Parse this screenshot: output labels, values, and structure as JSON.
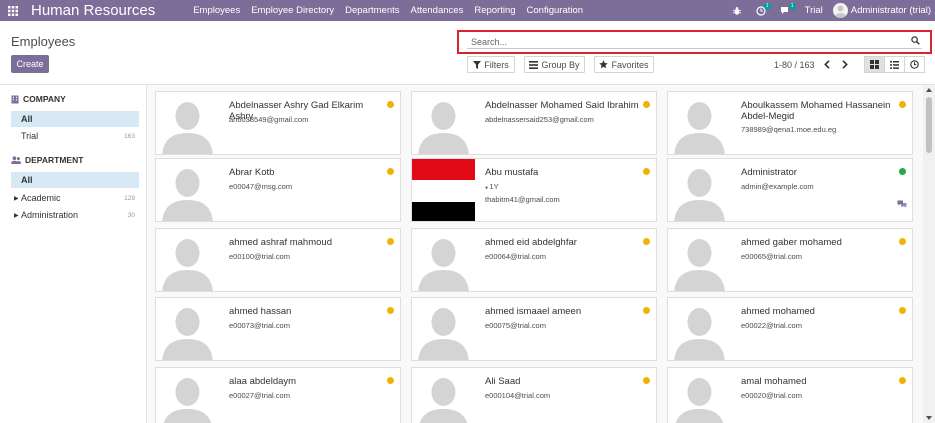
{
  "navbar": {
    "brand": "Human Resources",
    "menu": [
      "Employees",
      "Employee Directory",
      "Departments",
      "Attendances",
      "Reporting",
      "Configuration"
    ],
    "activity_badge": "1",
    "messages_badge": "1",
    "trial_label": "Trial",
    "user_label": "Administrator (trial)",
    "accent": "#7c6e99"
  },
  "control_panel": {
    "title": "Employees",
    "create_label": "Create",
    "search_placeholder": "Search...",
    "filters_label": "Filters",
    "group_by_label": "Group By",
    "favorites_label": "Favorites",
    "pager": "1-80 / 163"
  },
  "sidebar": {
    "company_heading": "COMPANY",
    "company_items": [
      {
        "label": "All",
        "count": ""
      },
      {
        "label": "Trial",
        "count": "163"
      }
    ],
    "department_heading": "DEPARTMENT",
    "department_items": [
      {
        "label": "All",
        "count": ""
      },
      {
        "label": "Academic",
        "count": "129"
      },
      {
        "label": "Administration",
        "count": "30"
      }
    ]
  },
  "employees": [
    {
      "name": "Abdelnasser Ashry Gad Elkarim Ashry",
      "email": "an6033549@gmail.com",
      "status": "yellow"
    },
    {
      "name": "Abdelnasser Mohamed Said Ibrahim",
      "email": "abdelnassersaid253@gmail.com",
      "status": "yellow"
    },
    {
      "name": "Aboulkassem Mohamed Hassanein Abdel-Megid",
      "email": "738989@qena1.moe.edu.eg",
      "status": "yellow"
    },
    {
      "name": "Abrar Kotb",
      "email": "e00047@msg.com",
      "status": "yellow"
    },
    {
      "name": "Abu mustafa",
      "tag": "1Y",
      "email": "thabitm41@gmail.com",
      "status": "yellow",
      "photo": "flag"
    },
    {
      "name": "Administrator",
      "email": "admin@example.com",
      "status": "green",
      "chat": true
    },
    {
      "name": "ahmed ashraf mahmoud",
      "email": "e00100@trial.com",
      "status": "yellow"
    },
    {
      "name": "ahmed eid abdelghfar",
      "email": "e00064@trial.com",
      "status": "yellow"
    },
    {
      "name": "ahmed gaber mohamed",
      "email": "e00065@trial.com",
      "status": "yellow"
    },
    {
      "name": "ahmed hassan",
      "email": "e00073@trial.com",
      "status": "yellow"
    },
    {
      "name": "ahmed ismaael ameen",
      "email": "e00075@trial.com",
      "status": "yellow"
    },
    {
      "name": "ahmed mohamed",
      "email": "e00022@trial.com",
      "status": "yellow"
    },
    {
      "name": "alaa abdeldaym",
      "email": "e00027@trial.com",
      "status": "yellow"
    },
    {
      "name": "Ali Saad",
      "email": "e000104@trial.com",
      "status": "yellow"
    },
    {
      "name": "amal mohamed",
      "email": "e00020@trial.com",
      "status": "yellow"
    }
  ]
}
